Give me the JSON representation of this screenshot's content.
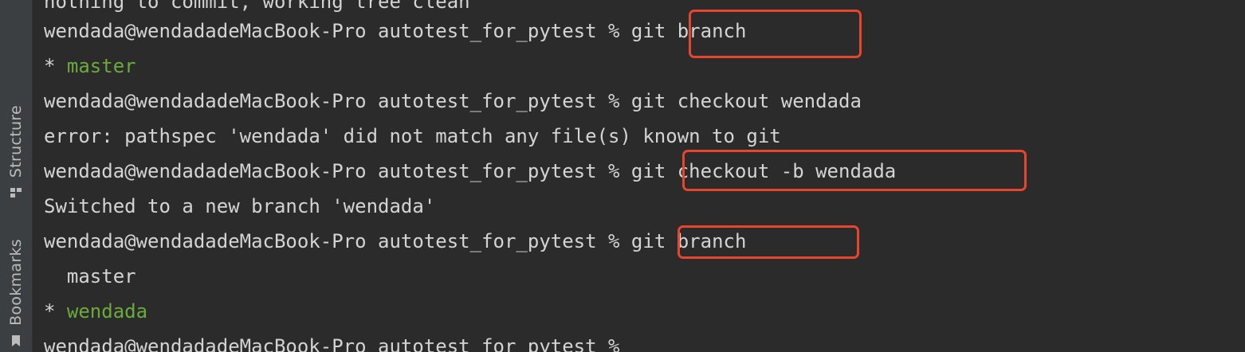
{
  "sidebar": {
    "tabs": [
      {
        "label": "Structure",
        "icon": "structure-icon"
      },
      {
        "label": "Bookmarks",
        "icon": "bookmark-icon"
      }
    ]
  },
  "terminal": {
    "lines": [
      {
        "prefix": "",
        "text": "nothing to commit, working tree clean"
      },
      {
        "prompt": "wendada@wendadadeMacBook-Pro autotest_for_pytest % ",
        "command": "git branch"
      },
      {
        "marker": "* ",
        "branch": "master"
      },
      {
        "prompt": "wendada@wendadadeMacBook-Pro autotest_for_pytest % ",
        "command": "git checkout wendada"
      },
      {
        "text": "error: pathspec 'wendada' did not match any file(s) known to git"
      },
      {
        "prompt": "wendada@wendadadeMacBook-Pro autotest_for_pytest % ",
        "command": "git checkout -b wendada"
      },
      {
        "text": "Switched to a new branch 'wendada'"
      },
      {
        "prompt": "wendada@wendadadeMacBook-Pro autotest_for_pytest % ",
        "command": "git branch"
      },
      {
        "text": "  master"
      },
      {
        "marker": "* ",
        "branch": "wendada"
      },
      {
        "prompt": "wendada@wendadadeMacBook-Pro autotest_for_pytest % "
      }
    ]
  },
  "colors": {
    "background": "#2b2b2b",
    "text": "#d4d4d4",
    "current_branch": "#6aab3c",
    "annotation_box": "#e8452f"
  }
}
